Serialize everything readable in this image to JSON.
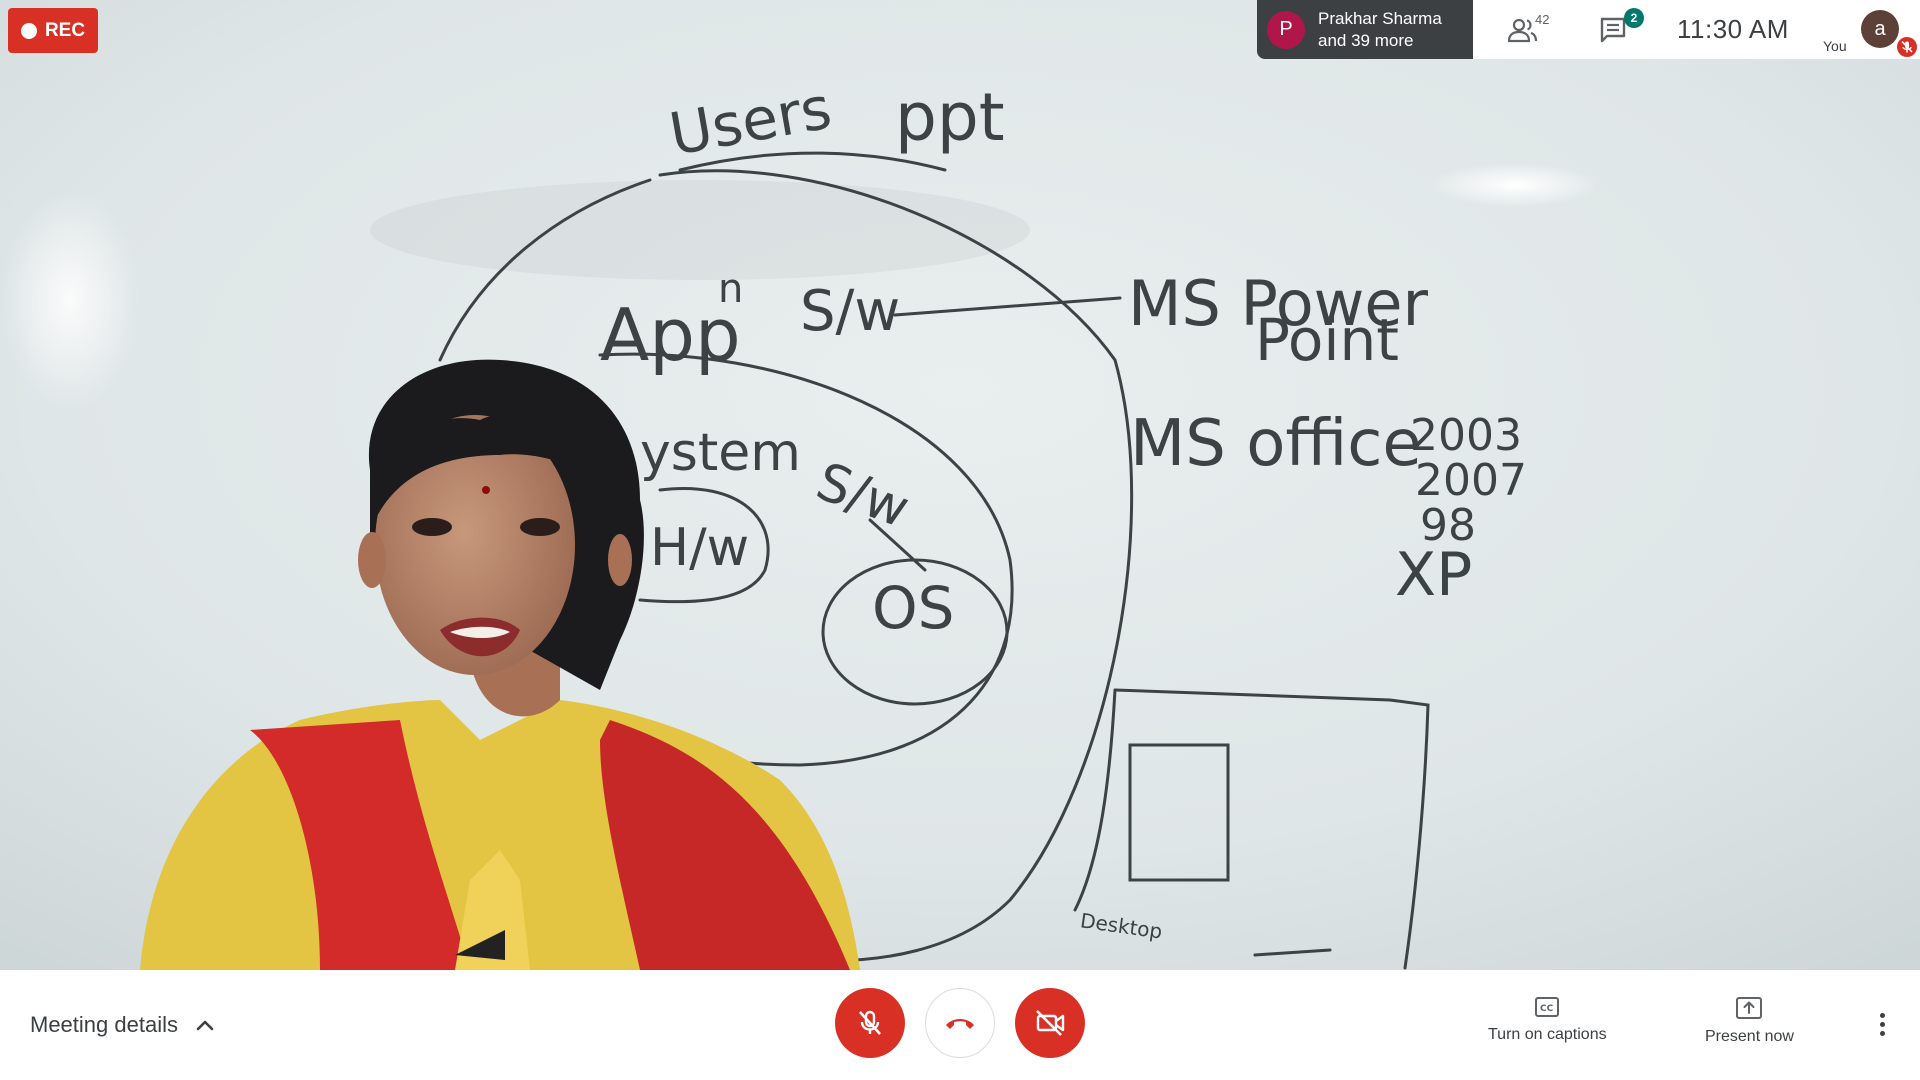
{
  "recording": {
    "label": "REC"
  },
  "presenter": {
    "initial": "P",
    "name_line1": "Prakhar Sharma",
    "name_line2": "and 39 more",
    "avatar_color": "#b0164a"
  },
  "topbar": {
    "people_icon": "people-icon",
    "participants_count": "42",
    "chat_icon": "chat-icon",
    "chat_badge": "2",
    "time": "11:30  AM",
    "self_initial": "a",
    "self_label": "You",
    "self_mic_icon": "mic-off-icon"
  },
  "whiteboard": {
    "texts": {
      "users": "Users",
      "ppt": "ppt",
      "apph": "App",
      "apph_sup": "n",
      "sw1": "S/w",
      "ms_power": "MS  Power",
      "point": "Point",
      "system": "ystem",
      "sw2": "S/w",
      "hw": "H/w",
      "os": "OS",
      "ms_office": "MS  office",
      "v2003": "2003",
      "v2007": "2007",
      "v98": "98",
      "vxp": "XP",
      "small": "Desktop"
    }
  },
  "bottombar": {
    "meeting_details": "Meeting details",
    "mic_button": "mic-off-icon",
    "hangup_button": "call-end-icon",
    "camera_button": "videocam-off-icon",
    "captions_label": "Turn on captions",
    "present_label": "Present now",
    "more_icon": "more-vert-icon"
  },
  "colors": {
    "danger": "#d93025",
    "panel_dark": "#3c4043",
    "badge": "#00796b"
  }
}
